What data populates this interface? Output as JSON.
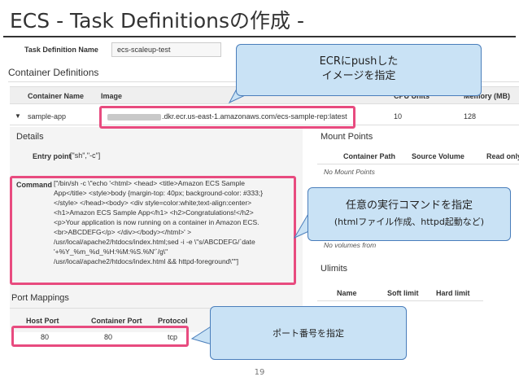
{
  "slide": {
    "title": "ECS - Task Definitionsの作成 -",
    "page_number": "19"
  },
  "console": {
    "task_definition_name_label": "Task Definition Name",
    "task_definition_name_value": "ecs-scaleup-test",
    "container_definitions_heading": "Container Definitions",
    "columns": {
      "container_name": "Container Name",
      "image": "Image",
      "cpu_units": "CPU Units",
      "memory": "Memory (MB)"
    },
    "container_row": {
      "name": "sample-app",
      "image_suffix": ".dkr.ecr.us-east-1.amazonaws.com/ecs-sample-rep:latest",
      "cpu": "10",
      "memory": "128"
    },
    "details": {
      "heading": "Details",
      "entry_point_label": "Entry point",
      "entry_point_value": "[\"sh\",\"-c\"]",
      "command_label": "Command",
      "command_lines": [
        "[\"/bin/sh -c \\\"echo '<html> <head> <title>Amazon ECS Sample",
        "App</title> <style>body {margin-top: 40px; background-color: #333;}",
        "</style> </head><body> <div style=color:white;text-align:center>",
        "<h1>Amazon ECS Sample App</h1> <h2>Congratulations!</h2>",
        "<p>Your application is now running on a container in Amazon ECS.",
        "<br>ABCDEFG</p> </div></body></html>' >",
        "/usr/local/apache2/htdocs/index.html;sed -i -e \\\"s/ABCDEFG/`date",
        "'+%Y_%m_%d_%H:%M:%S.%N'`/g\\\"",
        "/usr/local/apache2/htdocs/index.html && httpd-foreground\\\"\"]"
      ]
    },
    "mount_points": {
      "heading": "Mount Points",
      "columns": [
        "Container Path",
        "Source Volume",
        "Read only"
      ],
      "empty_text": "No Mount Points"
    },
    "volumes_from": {
      "empty_text": "No volumes from"
    },
    "ulimits": {
      "heading": "Ulimits",
      "columns": [
        "Name",
        "Soft limit",
        "Hard limit"
      ]
    },
    "port_mappings": {
      "heading": "Port Mappings",
      "columns": [
        "Host Port",
        "Container Port",
        "Protocol"
      ],
      "rows": [
        {
          "host": "80",
          "container": "80",
          "protocol": "tcp"
        }
      ]
    }
  },
  "callouts": {
    "ecr": {
      "line1": "ECRにpushした",
      "line2": "イメージを指定"
    },
    "command": {
      "line1": "任意の実行コマンドを指定",
      "line2": "(htmlファイル作成、httpd起動など)"
    },
    "port": {
      "line1": "ポート番号を指定"
    }
  },
  "colors": {
    "highlight": "#e84b7f",
    "callout_fill": "#c9e2f5",
    "callout_border": "#4a7ebb"
  }
}
